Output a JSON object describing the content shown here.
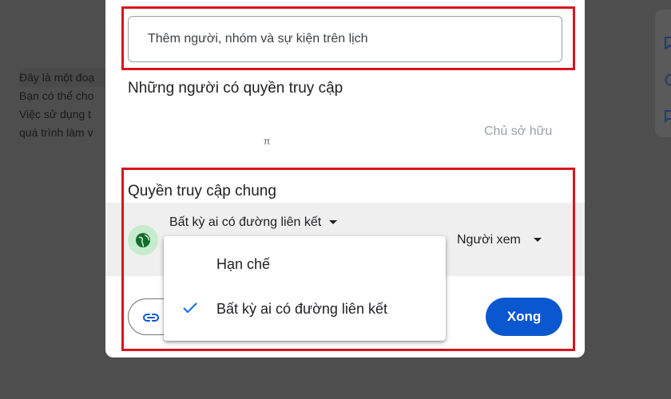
{
  "background_doc": {
    "lines": [
      "Đây là một đoạ",
      "Bạn có thể cho",
      "Việc sử dụng t",
      "quá trình làm v"
    ]
  },
  "dialog": {
    "search": {
      "placeholder": "Thêm người, nhóm và sự kiện trên lịch",
      "value": ""
    },
    "people_section_title": "Những người có quyền truy cập",
    "owner_label": "Chủ sở hữu",
    "owner_glyph": "π",
    "general_access_title": "Quyền truy cập chung",
    "access_selected": "Bất kỳ ai có đường liên kết",
    "role_selected": "Người xem",
    "done_label": "Xong",
    "icons": {
      "globe": "globe-icon",
      "link": "link-icon",
      "check": "check-icon"
    }
  },
  "access_menu": {
    "items": [
      {
        "label": "Hạn chế",
        "selected": false
      },
      {
        "label": "Bất kỳ ai có đường liên kết",
        "selected": true
      }
    ]
  },
  "colors": {
    "highlight_box": "#d9151f",
    "primary_button": "#0b57d0",
    "globe_bg": "#c6ebcd",
    "check": "#1a73e8"
  }
}
